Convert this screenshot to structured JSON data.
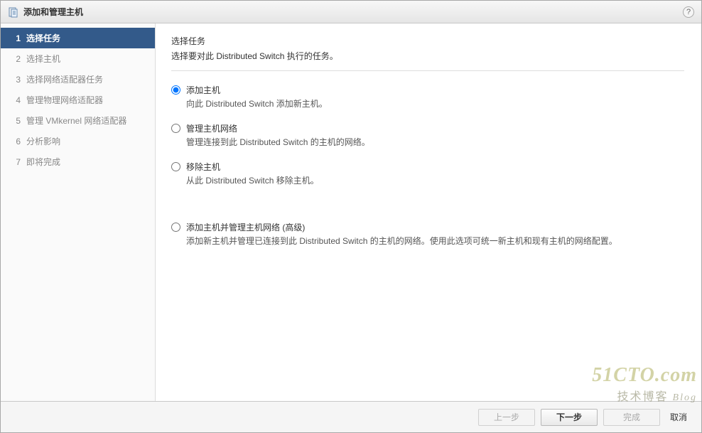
{
  "dialog": {
    "title": "添加和管理主机"
  },
  "sidebar": {
    "steps": [
      {
        "num": "1",
        "label": "选择任务"
      },
      {
        "num": "2",
        "label": "选择主机"
      },
      {
        "num": "3",
        "label": "选择网络适配器任务"
      },
      {
        "num": "4",
        "label": "管理物理网络适配器"
      },
      {
        "num": "5",
        "label": "管理 VMkernel 网络适配器"
      },
      {
        "num": "6",
        "label": "分析影响"
      },
      {
        "num": "7",
        "label": "即将完成"
      }
    ]
  },
  "content": {
    "heading": "选择任务",
    "subtitle": "选择要对此 Distributed Switch 执行的任务。",
    "options": [
      {
        "id": "add-hosts",
        "label": "添加主机",
        "desc": "向此 Distributed Switch 添加新主机。",
        "checked": true
      },
      {
        "id": "manage-net",
        "label": "管理主机网络",
        "desc": "管理连接到此 Distributed Switch 的主机的网络。",
        "checked": false
      },
      {
        "id": "remove-hosts",
        "label": "移除主机",
        "desc": "从此 Distributed Switch 移除主机。",
        "checked": false
      },
      {
        "id": "advanced",
        "label": "添加主机并管理主机网络 (高级)",
        "desc": "添加新主机并管理已连接到此 Distributed Switch 的主机的网络。使用此选项可统一新主机和现有主机的网络配置。",
        "checked": false
      }
    ]
  },
  "footer": {
    "back": "上一步",
    "next": "下一步",
    "finish": "完成",
    "cancel": "取消"
  },
  "watermark": {
    "line1": "51CTO.com",
    "line2_a": "技术博客",
    "line2_b": "Blog"
  }
}
